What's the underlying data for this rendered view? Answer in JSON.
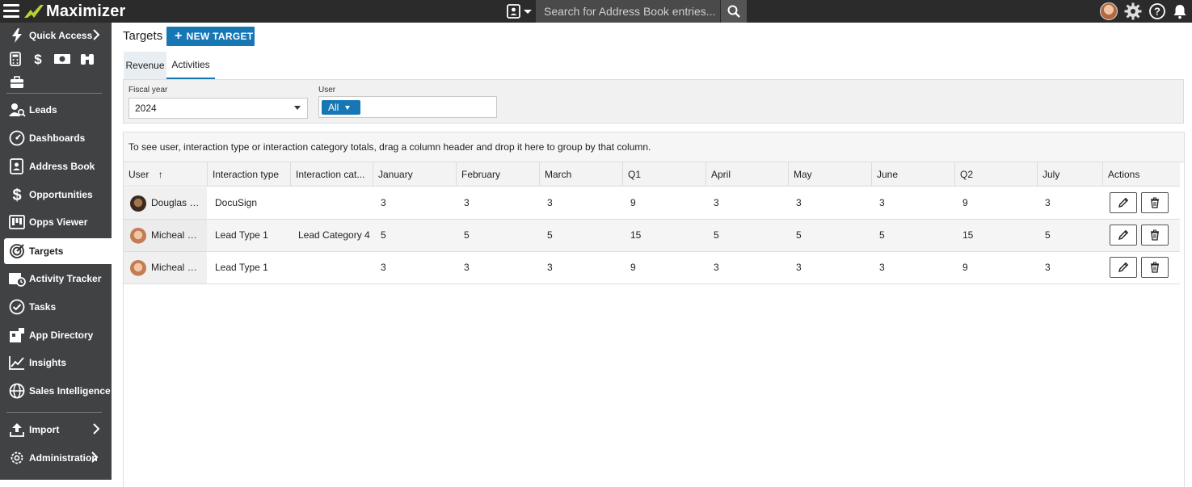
{
  "app": {
    "name": "Maximizer"
  },
  "topbar": {
    "search_placeholder": "Search for Address Book entries...",
    "icons": [
      "menu-icon",
      "address-book-icon",
      "search-icon",
      "avatar",
      "gear-icon",
      "help-icon",
      "bell-icon"
    ]
  },
  "sidebar": {
    "quick_access": "Quick Access",
    "items": [
      {
        "label": "Leads",
        "icon": "leads-icon"
      },
      {
        "label": "Dashboards",
        "icon": "dashboard-icon"
      },
      {
        "label": "Address Book",
        "icon": "address-book-icon"
      },
      {
        "label": "Opportunities",
        "icon": "dollar-icon"
      },
      {
        "label": "Opps Viewer",
        "icon": "kanban-icon"
      },
      {
        "label": "Targets",
        "icon": "target-icon",
        "active": true
      },
      {
        "label": "Activity Tracker",
        "icon": "calendar-clock-icon"
      },
      {
        "label": "Tasks",
        "icon": "check-circle-icon"
      },
      {
        "label": "App Directory",
        "icon": "puzzle-icon"
      },
      {
        "label": "Insights",
        "icon": "chart-line-icon"
      },
      {
        "label": "Sales Intelligence",
        "icon": "globe-icon"
      }
    ],
    "import": "Import",
    "administration": "Administration"
  },
  "page": {
    "title": "Targets",
    "new_button": "NEW TARGET",
    "tabs": [
      "Revenue",
      "Activities"
    ],
    "active_tab": "Activities"
  },
  "filters": {
    "fiscal_year_label": "Fiscal year",
    "fiscal_year_value": "2024",
    "user_label": "User",
    "user_value": "All"
  },
  "grid": {
    "group_hint": "To see user, interaction type or interaction category totals, drag a column header and drop it here to group by that column.",
    "columns": [
      "User",
      "Interaction type",
      "Interaction cat...",
      "January",
      "February",
      "March",
      "Q1",
      "April",
      "May",
      "June",
      "Q2",
      "July",
      "Actions"
    ],
    "sort_indicator": "↑",
    "rows": [
      {
        "user": "Douglas C...",
        "avatar": "dark",
        "type": "DocuSign",
        "category": "",
        "jan": "3",
        "feb": "3",
        "mar": "3",
        "q1": "9",
        "apr": "3",
        "may": "3",
        "jun": "3",
        "q2": "9",
        "jul": "3"
      },
      {
        "user": "Micheal B...",
        "avatar": "light",
        "type": "Lead Type 1",
        "category": "Lead Category 4",
        "jan": "5",
        "feb": "5",
        "mar": "5",
        "q1": "15",
        "apr": "5",
        "may": "5",
        "jun": "5",
        "q2": "15",
        "jul": "5"
      },
      {
        "user": "Micheal B...",
        "avatar": "light",
        "type": "Lead Type 1",
        "category": "",
        "jan": "3",
        "feb": "3",
        "mar": "3",
        "q1": "9",
        "apr": "3",
        "may": "3",
        "jun": "3",
        "q2": "9",
        "jul": "3"
      }
    ]
  },
  "colors": {
    "brand_blue": "#1777b5",
    "sidebar_bg": "#404244",
    "topbar_bg": "#2b2b2b",
    "logo_green": "#b5d334"
  }
}
